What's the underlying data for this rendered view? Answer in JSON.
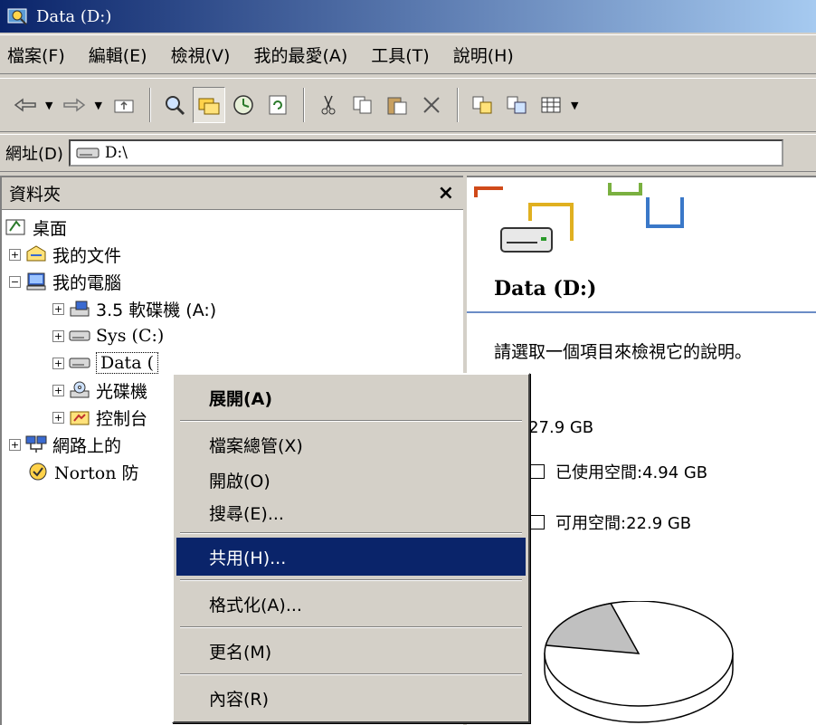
{
  "window": {
    "title": "Data (D:)"
  },
  "menubar": {
    "items": [
      "檔案(F)",
      "編輯(E)",
      "檢視(V)",
      "我的最愛(A)",
      "工具(T)",
      "說明(H)"
    ]
  },
  "toolbar": {
    "buttons": [
      "back-icon",
      "forward-icon",
      "up-folder-icon",
      "search-icon",
      "folders-icon",
      "history-icon",
      "refresh-icon",
      "cut-icon",
      "copy-icon",
      "paste-icon",
      "delete-icon",
      "move-to-icon",
      "copy-to-icon",
      "views-icon"
    ]
  },
  "address": {
    "label": "網址(D)",
    "value": "D:\\"
  },
  "folders": {
    "header": "資料夾",
    "close": "×",
    "tree": [
      {
        "label": "桌面"
      },
      {
        "label": "我的文件"
      },
      {
        "label": "我的電腦"
      },
      {
        "label": "3.5 軟碟機 (A:)"
      },
      {
        "label": "Sys (C:)"
      },
      {
        "label": "Data ("
      },
      {
        "label": "光碟機"
      },
      {
        "label": "控制台"
      },
      {
        "label": "網路上的"
      },
      {
        "label": "Norton 防"
      }
    ]
  },
  "details": {
    "title": "Data (D:)",
    "hint": "請選取一個項目來檢視它的說明。",
    "capacity": "量:27.9 GB",
    "used": "已使用空間:4.94 GB",
    "free": "可用空間:22.9 GB",
    "pie": {
      "used_fraction": 0.177
    }
  },
  "context_menu": {
    "items": [
      "展開(A)",
      "檔案總管(X)",
      "開啟(O)",
      "搜尋(E)...",
      "共用(H)...",
      "格式化(A)...",
      "更名(M)",
      "內容(R)"
    ]
  },
  "colors": {
    "selection": "#0a246a",
    "face": "#d4d0c8",
    "title_start": "#0a246a",
    "title_end": "#a6caf0"
  }
}
